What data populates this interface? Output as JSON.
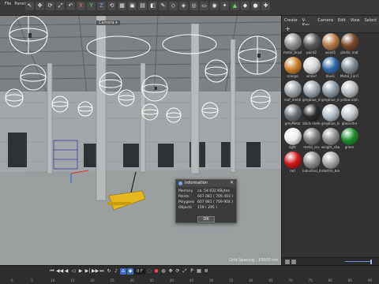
{
  "menu": [
    "",
    "File",
    "Panel"
  ],
  "toolbar": {
    "icons": [
      {
        "name": "live-selection-icon",
        "glyph": "↖",
        "tone": ""
      },
      {
        "name": "move-icon",
        "glyph": "✥",
        "tone": ""
      },
      {
        "name": "rotate-icon",
        "glyph": "⟳",
        "tone": ""
      },
      {
        "name": "scale-icon",
        "glyph": "⤢",
        "tone": ""
      },
      {
        "name": "undo-icon",
        "glyph": "↶",
        "tone": ""
      },
      {
        "name": "axis-x-icon",
        "glyph": "X",
        "tone": "red"
      },
      {
        "name": "axis-y-icon",
        "glyph": "Y",
        "tone": "green"
      },
      {
        "name": "axis-z-icon",
        "glyph": "Z",
        "tone": "blue"
      },
      {
        "name": "world-coords-icon",
        "glyph": "⟲",
        "tone": ""
      },
      {
        "name": "render-region-icon",
        "glyph": "▦",
        "tone": ""
      },
      {
        "name": "render-view-icon",
        "glyph": "▣",
        "tone": ""
      },
      {
        "name": "render-settings-icon",
        "glyph": "▤",
        "tone": ""
      },
      {
        "name": "cube-icon",
        "glyph": "◧",
        "tone": ""
      },
      {
        "name": "pen-icon",
        "glyph": "✎",
        "tone": ""
      },
      {
        "name": "subdivision-icon",
        "glyph": "◇",
        "tone": ""
      },
      {
        "name": "array-icon",
        "glyph": "◈",
        "tone": ""
      },
      {
        "name": "deformer-icon",
        "glyph": "◎",
        "tone": ""
      },
      {
        "name": "floor-icon",
        "glyph": "▭",
        "tone": ""
      },
      {
        "name": "camera-icon",
        "glyph": "◉",
        "tone": ""
      },
      {
        "name": "light-icon",
        "glyph": "✦",
        "tone": ""
      },
      {
        "name": "tag-icon",
        "glyph": "▲",
        "tone": "green"
      },
      {
        "name": "generator-icon",
        "glyph": "◆",
        "tone": ""
      },
      {
        "name": "sphere-icon",
        "glyph": "●",
        "tone": ""
      },
      {
        "name": "plugin-icon",
        "glyph": "✚",
        "tone": ""
      }
    ]
  },
  "viewport": {
    "tab": "Camera ▾",
    "grid_spacing": "Grid Spacing : 10000 cm"
  },
  "panel": {
    "menu": [
      "Create",
      "V-Ray",
      "Camera",
      "Edit",
      "View",
      "Select"
    ],
    "add": "+",
    "materials": [
      {
        "label": "metal_brush",
        "color": "#8f8f8f"
      },
      {
        "label": "paint2",
        "color": "#5a5a5a"
      },
      {
        "label": "wood1",
        "color": "#b57a45"
      },
      {
        "label": "plastic mat",
        "color": "#7a4a2a"
      },
      {
        "label": "orange",
        "color": "#cc7f2b"
      },
      {
        "label": "white?",
        "color": "#d4d4d4"
      },
      {
        "label": "blue1",
        "color": "#2e6aa8"
      },
      {
        "label": "Metal_Corr1",
        "color": "#7f8a93"
      },
      {
        "label": "roof_metal",
        "color": "#a0a4a8"
      },
      {
        "label": "greyblue_m",
        "color": "#9aa6b0"
      },
      {
        "label": "greyblue_rc",
        "color": "#8b97a0"
      },
      {
        "label": "yellow alpha",
        "color": "#b9bdc0"
      },
      {
        "label": "greyMetal",
        "color": "#6c7278"
      },
      {
        "label": "black mate",
        "color": "#2a2a2a"
      },
      {
        "label": "greyblue_hi",
        "color": "#b6c0c8"
      },
      {
        "label": "glassvitre",
        "color": "#c3c9cc"
      },
      {
        "label": "light",
        "color": "#eeeeee"
      },
      {
        "label": "metal_scu",
        "color": "#7d7d7d"
      },
      {
        "label": "weight_shw",
        "color": "#909090"
      },
      {
        "label": "green",
        "color": "#1e8f2a"
      },
      {
        "label": "red",
        "color": "#d01818"
      },
      {
        "label": "industrial_d",
        "color": "#8e8e8e"
      },
      {
        "label": "electric_box",
        "color": "#a8a8a8"
      }
    ]
  },
  "dialog": {
    "title": "Information",
    "close": "✕",
    "rows": [
      {
        "key": "Memory",
        "value": "ca. 54 832 KBytes"
      },
      {
        "key": "Points",
        "value": "607 081 ( 709 493 )"
      },
      {
        "key": "Polygons",
        "value": "607 881 ( 709 904 )"
      },
      {
        "key": "Objects",
        "value": "159 ( 295 )"
      }
    ],
    "ok": "OK"
  },
  "timeline": {
    "frame": "0 F",
    "ruler": [
      "0",
      "5",
      "10",
      "15",
      "20",
      "25",
      "30",
      "35",
      "40",
      "45",
      "50",
      "55",
      "60",
      "65",
      "70",
      "75",
      "80",
      "85",
      "90"
    ]
  }
}
